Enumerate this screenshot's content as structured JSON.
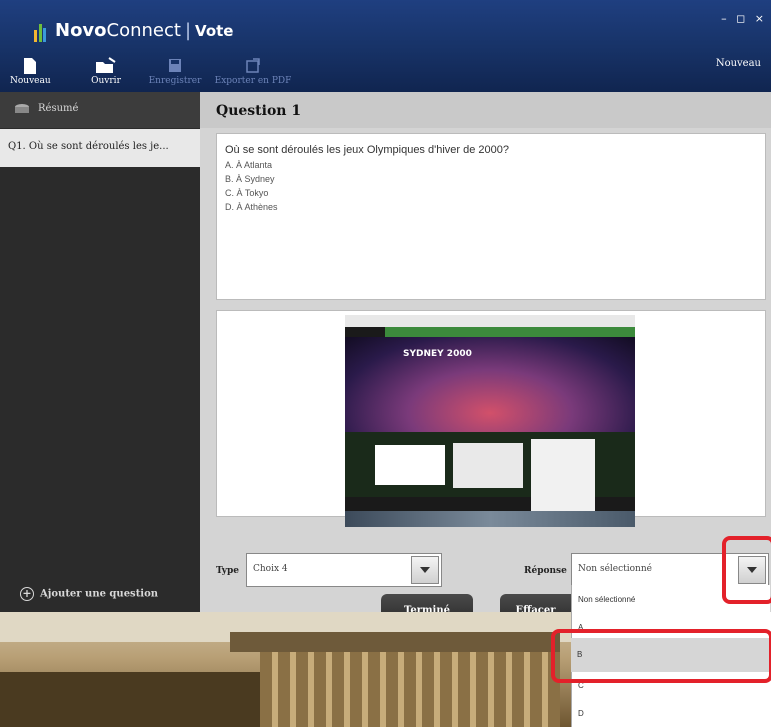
{
  "window": {
    "app_name_bold": "Novo",
    "app_name_rest": "Connect",
    "separator": "|",
    "subtitle": "Vote",
    "controls": "– ◻ ×",
    "toolbar_right": "Nouveau"
  },
  "toolbar": {
    "items": [
      {
        "label": "Nouveau",
        "icon": "new-file-icon",
        "enabled": true
      },
      {
        "label": "Ouvrir",
        "icon": "open-folder-icon",
        "enabled": true
      },
      {
        "label": "Enregistrer",
        "icon": "save-icon",
        "enabled": false
      },
      {
        "label": "Exporter en PDF",
        "icon": "export-icon",
        "enabled": false
      }
    ]
  },
  "sidebar": {
    "header": "Résumé",
    "items": [
      {
        "label": "Q1. Où se sont déroulés les je..."
      }
    ],
    "add_question": "Ajouter une question"
  },
  "main": {
    "title": "Question 1",
    "question": "Où se sont déroulés les jeux Olympiques d'hiver de 2000?",
    "options": [
      "A. À Atlanta",
      "B. À Sydney",
      "C. À Tokyo",
      "D. À Athènes"
    ],
    "image_title": "SYDNEY 2000",
    "type_label": "Type",
    "type_value": "Choix 4",
    "answer_label": "Réponse",
    "answer_value": "Non sélectionné",
    "done_button": "Terminé",
    "clear_button": "Effacer"
  },
  "dropdown": {
    "items": [
      "Non sélectionné",
      "A",
      "B",
      "C",
      "D"
    ],
    "highlighted": "B"
  },
  "colors": {
    "titlebar": "#1f3f80",
    "sidebar": "#2b2b2b",
    "panel": "#d4d4d4",
    "highlight_red": "#e3212a"
  }
}
